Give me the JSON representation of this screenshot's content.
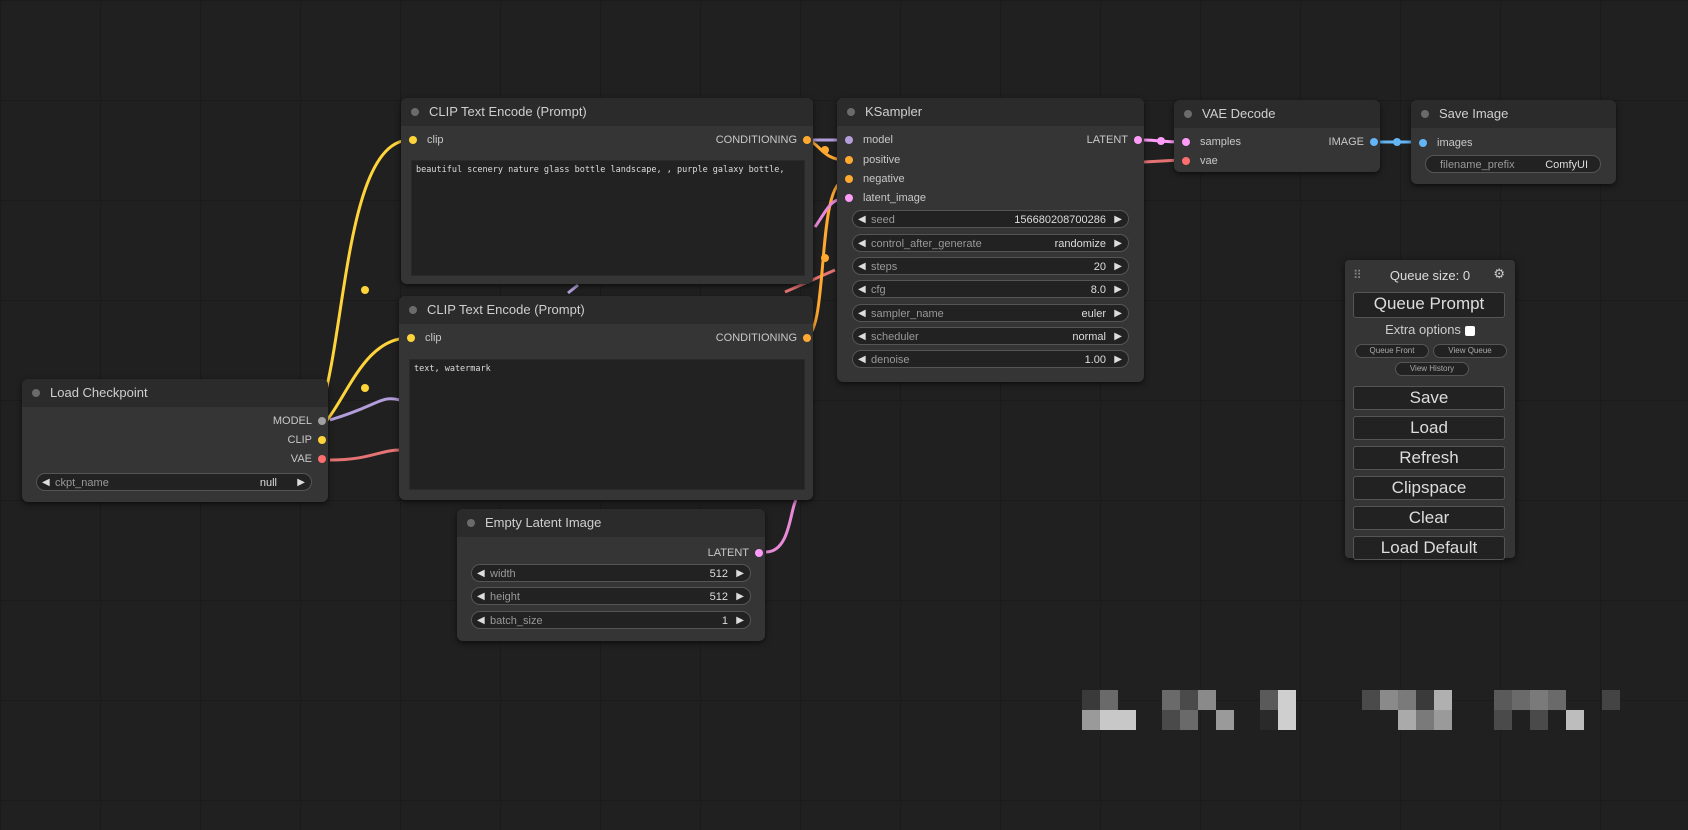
{
  "nodes": {
    "clip_text_1": {
      "title": "CLIP Text Encode (Prompt)",
      "input": "clip",
      "output": "CONDITIONING",
      "text": "beautiful scenery nature glass bottle landscape, , purple galaxy bottle,"
    },
    "clip_text_2": {
      "title": "CLIP Text Encode (Prompt)",
      "input": "clip",
      "output": "CONDITIONING",
      "text": "text, watermark"
    },
    "ksampler": {
      "title": "KSampler",
      "inputs": [
        "model",
        "positive",
        "negative",
        "latent_image"
      ],
      "output": "LATENT",
      "widgets": [
        {
          "label": "seed",
          "value": "156680208700286"
        },
        {
          "label": "control_after_generate",
          "value": "randomize"
        },
        {
          "label": "steps",
          "value": "20"
        },
        {
          "label": "cfg",
          "value": "8.0"
        },
        {
          "label": "sampler_name",
          "value": "euler"
        },
        {
          "label": "scheduler",
          "value": "normal"
        },
        {
          "label": "denoise",
          "value": "1.00"
        }
      ]
    },
    "vae_decode": {
      "title": "VAE Decode",
      "inputs": [
        "samples",
        "vae"
      ],
      "output": "IMAGE"
    },
    "save_image": {
      "title": "Save Image",
      "input": "images",
      "widget": {
        "label": "filename_prefix",
        "value": "ComfyUI"
      }
    },
    "load_checkpoint": {
      "title": "Load Checkpoint",
      "outputs": [
        "MODEL",
        "CLIP",
        "VAE"
      ],
      "widget": {
        "label": "ckpt_name",
        "value": "null"
      }
    },
    "empty_latent": {
      "title": "Empty Latent Image",
      "output": "LATENT",
      "widgets": [
        {
          "label": "width",
          "value": "512"
        },
        {
          "label": "height",
          "value": "512"
        },
        {
          "label": "batch_size",
          "value": "1"
        }
      ]
    }
  },
  "menu": {
    "queue_size": "Queue size: 0",
    "queue_prompt": "Queue Prompt",
    "extra_options": "Extra options",
    "queue_front": "Queue Front",
    "view_queue": "View Queue",
    "view_history": "View History",
    "save": "Save",
    "load": "Load",
    "refresh": "Refresh",
    "clipspace": "Clipspace",
    "clear": "Clear",
    "load_default": "Load Default"
  },
  "colors": {
    "clip": "#ffd43b",
    "conditioning": "#ffa931",
    "model": "#b39ddb",
    "latent": "#ff9cf9",
    "vae": "#ff6e6e",
    "image": "#64b5f6"
  }
}
